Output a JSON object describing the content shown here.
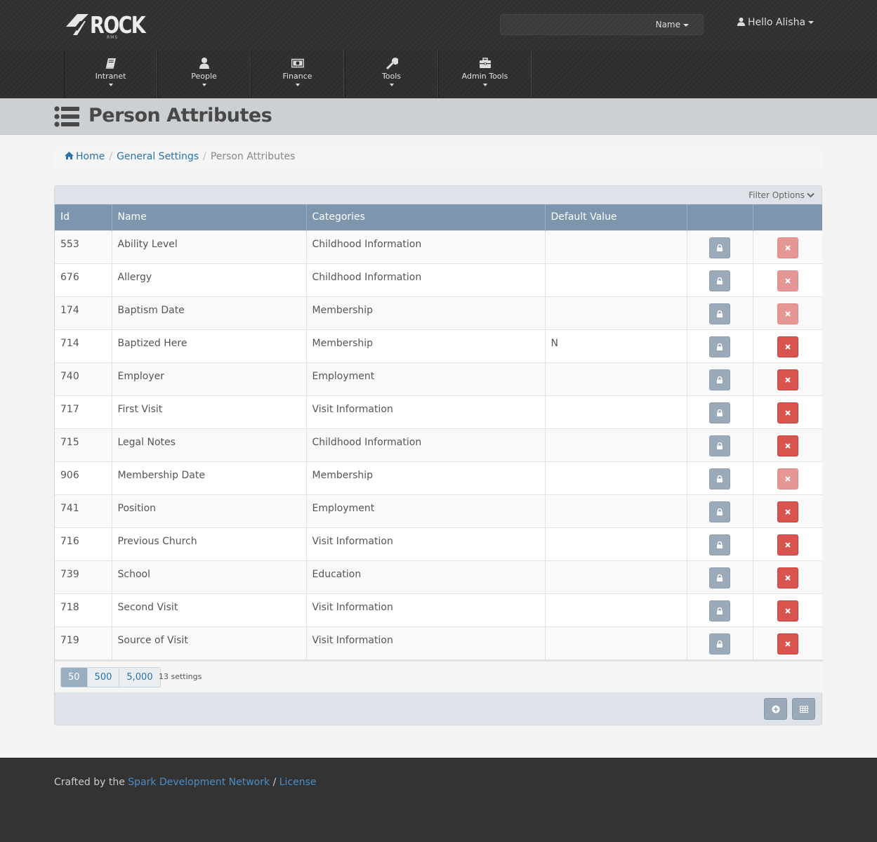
{
  "header": {
    "logo_text": "ROCK",
    "logo_sub": "RMS",
    "search_placeholder": "",
    "search_scope": "Name",
    "user_greeting": "Hello Alisha"
  },
  "nav": {
    "items": [
      {
        "label": "Intranet",
        "icon": "book-icon"
      },
      {
        "label": "People",
        "icon": "user-icon"
      },
      {
        "label": "Finance",
        "icon": "money-icon"
      },
      {
        "label": "Tools",
        "icon": "wrench-icon"
      },
      {
        "label": "Admin Tools",
        "icon": "briefcase-icon"
      }
    ]
  },
  "page": {
    "title": "Person Attributes"
  },
  "breadcrumb": {
    "home": "Home",
    "general": "General Settings",
    "current": "Person Attributes"
  },
  "grid": {
    "filter_label": "Filter Options",
    "columns": [
      "Id",
      "Name",
      "Categories",
      "Default Value"
    ],
    "rows": [
      {
        "id": "553",
        "name": "Ability Level",
        "category": "Childhood Information",
        "default": "",
        "delete_enabled": false
      },
      {
        "id": "676",
        "name": "Allergy",
        "category": "Childhood Information",
        "default": "",
        "delete_enabled": false
      },
      {
        "id": "174",
        "name": "Baptism Date",
        "category": "Membership",
        "default": "",
        "delete_enabled": false
      },
      {
        "id": "714",
        "name": "Baptized Here",
        "category": "Membership",
        "default": "N",
        "delete_enabled": true
      },
      {
        "id": "740",
        "name": "Employer",
        "category": "Employment",
        "default": "",
        "delete_enabled": true
      },
      {
        "id": "717",
        "name": "First Visit",
        "category": "Visit Information",
        "default": "",
        "delete_enabled": true
      },
      {
        "id": "715",
        "name": "Legal Notes",
        "category": "Childhood Information",
        "default": "",
        "delete_enabled": true
      },
      {
        "id": "906",
        "name": "Membership Date",
        "category": "Membership",
        "default": "",
        "delete_enabled": false
      },
      {
        "id": "741",
        "name": "Position",
        "category": "Employment",
        "default": "",
        "delete_enabled": true
      },
      {
        "id": "716",
        "name": "Previous Church",
        "category": "Visit Information",
        "default": "",
        "delete_enabled": true
      },
      {
        "id": "739",
        "name": "School",
        "category": "Education",
        "default": "",
        "delete_enabled": true
      },
      {
        "id": "718",
        "name": "Second Visit",
        "category": "Visit Information",
        "default": "",
        "delete_enabled": true
      },
      {
        "id": "719",
        "name": "Source of Visit",
        "category": "Visit Information",
        "default": "",
        "delete_enabled": true
      }
    ],
    "page_sizes": [
      "50",
      "500",
      "5,000"
    ],
    "active_page_size": "50",
    "item_count": "13 settings"
  },
  "footer": {
    "prefix": "Crafted by the",
    "network": "Spark Development Network",
    "slash": "/",
    "license": "License"
  },
  "colors": {
    "grid_header": "#7d96ae",
    "delete_button": "#d9534f",
    "delete_button_disabled": "#e69795",
    "lock_button": "#9aaab9",
    "link": "#2a72a9"
  }
}
